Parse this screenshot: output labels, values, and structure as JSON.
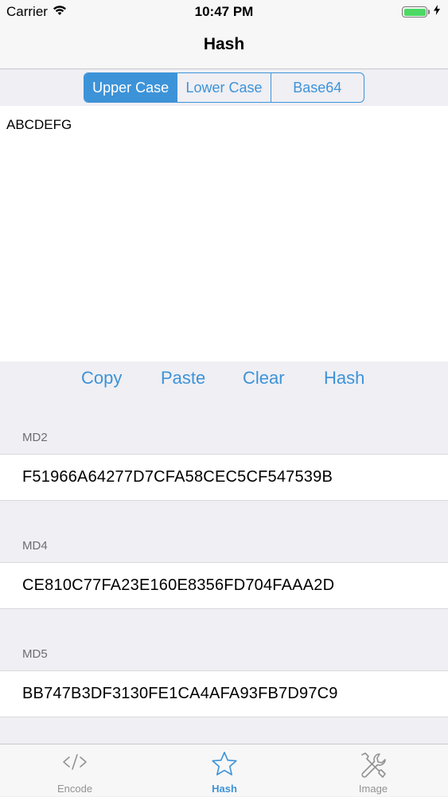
{
  "status_bar": {
    "carrier": "Carrier",
    "time": "10:47 PM",
    "battery_level": 1.0,
    "battery_color": "#4cd964",
    "wifi_icon": "wifi-icon",
    "charging_icon": "bolt-icon"
  },
  "nav": {
    "title": "Hash"
  },
  "segments": {
    "items": [
      "Upper Case",
      "Lower Case",
      "Base64"
    ],
    "selected_index": 0
  },
  "input": {
    "value": "ABCDEFG"
  },
  "actions": {
    "copy": "Copy",
    "paste": "Paste",
    "clear": "Clear",
    "hash": "Hash"
  },
  "results": [
    {
      "label": "MD2",
      "value": "F51966A64277D7CFA58CEC5CF547539B"
    },
    {
      "label": "MD4",
      "value": "CE810C77FA23E160E8356FD704FAAA2D"
    },
    {
      "label": "MD5",
      "value": "BB747B3DF3130FE1CA4AFA93FB7D97C9"
    }
  ],
  "tabs": [
    {
      "label": "Encode",
      "icon": "code-icon",
      "active": false
    },
    {
      "label": "Hash",
      "icon": "star-icon",
      "active": true
    },
    {
      "label": "Image",
      "icon": "tools-icon",
      "active": false
    }
  ],
  "colors": {
    "accent": "#3d93d8",
    "inactive_tab": "#929292"
  }
}
